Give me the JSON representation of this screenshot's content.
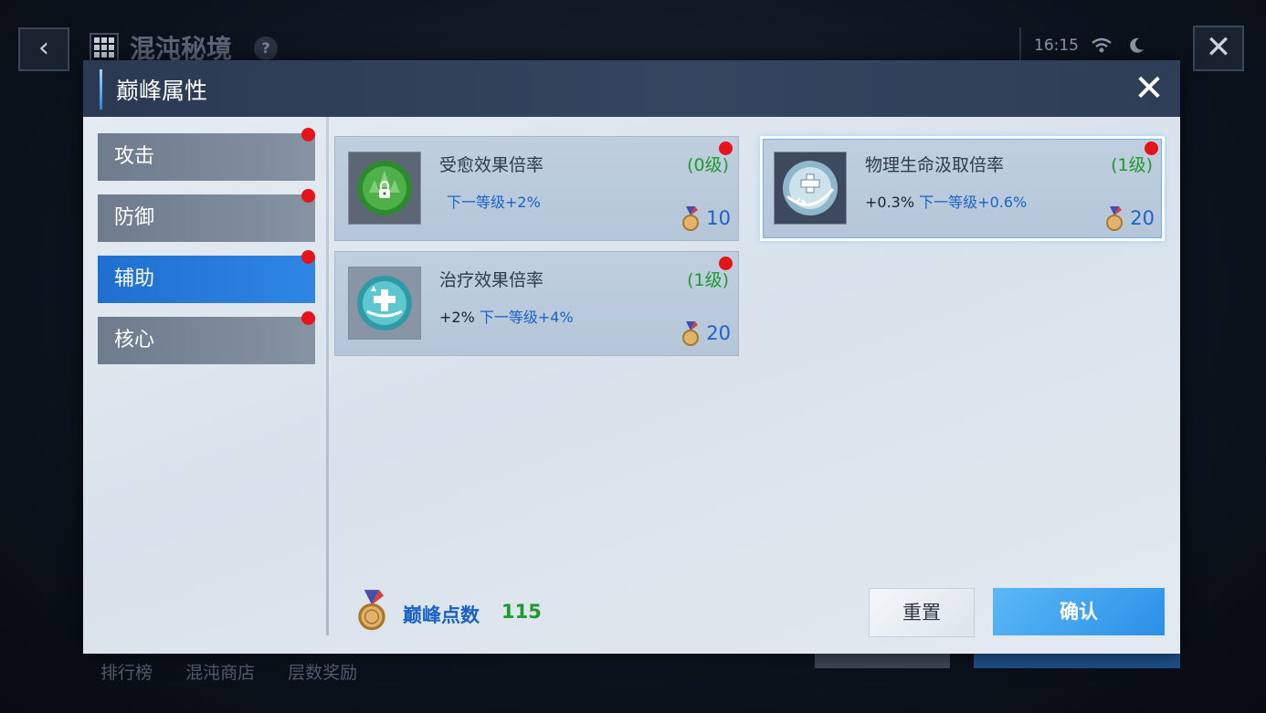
{
  "background": {
    "title": "混沌秘境",
    "help": "?",
    "status_time": "16:15",
    "bottom_links": [
      "排行榜",
      "混沌商店",
      "层数奖励"
    ]
  },
  "dialog": {
    "title": "巅峰属性",
    "tabs": [
      {
        "label": "攻击",
        "active": false,
        "dot": true
      },
      {
        "label": "防御",
        "active": false,
        "dot": true
      },
      {
        "label": "辅助",
        "active": true,
        "dot": true
      },
      {
        "label": "核心",
        "active": false,
        "dot": true
      }
    ],
    "cards": [
      {
        "name": "受愈效果倍率",
        "level": "(0级)",
        "current": "",
        "next": "下一等级+2%",
        "cost": "10",
        "icon": "heal-received-locked-icon"
      },
      {
        "name": "治疗效果倍率",
        "level": "(1级)",
        "current": "+2%",
        "next": "下一等级+4%",
        "cost": "20",
        "icon": "healing-cross-icon"
      },
      {
        "name": "物理生命汲取倍率",
        "level": "(1级)",
        "current": "+0.3%",
        "next": "下一等级+0.6%",
        "cost": "20",
        "icon": "life-steal-icon"
      }
    ],
    "points": {
      "label": "巅峰点数",
      "value": "115"
    },
    "buttons": {
      "reset": "重置",
      "confirm": "确认"
    }
  },
  "colors": {
    "accent_blue": "#2f86e4",
    "level_green": "#1c9a2c",
    "alert_red": "#e4141a"
  }
}
